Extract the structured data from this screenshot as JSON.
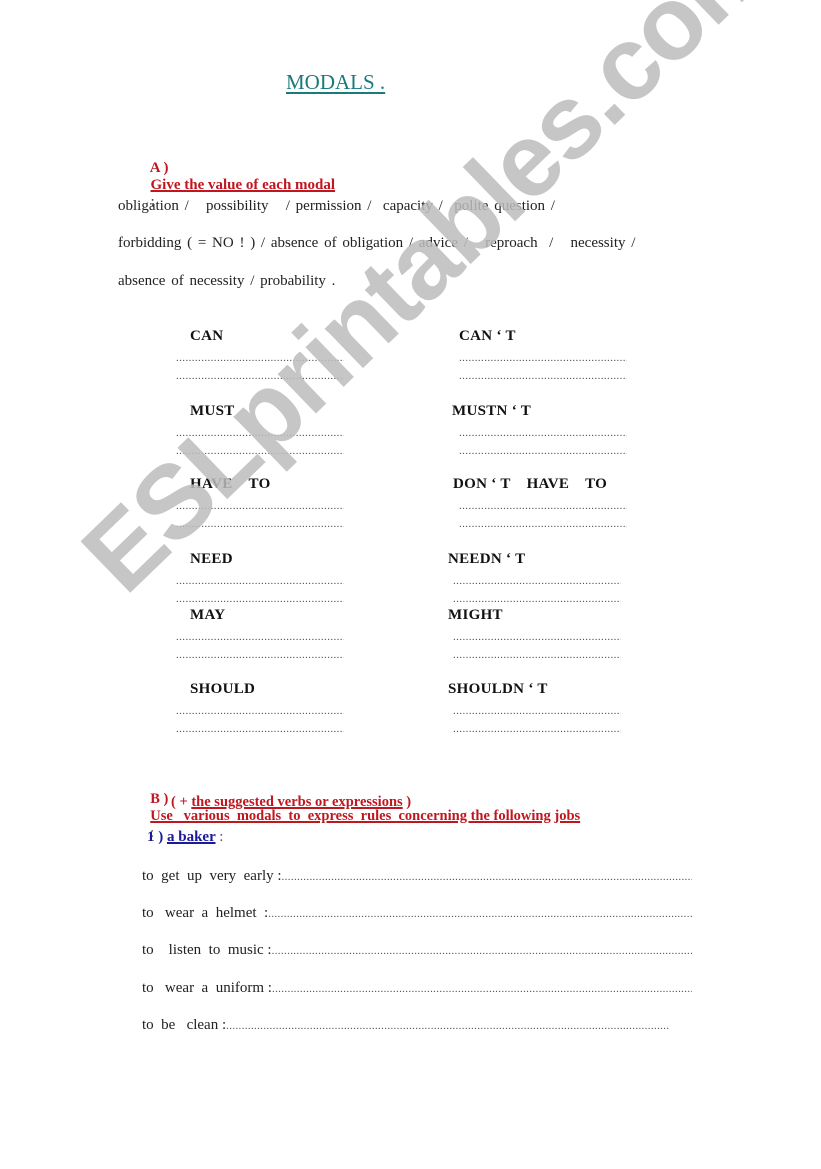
{
  "title": "MODALS .",
  "section_a": {
    "label": "A )",
    "instruction": "Give the value of each modal",
    "colon": ":",
    "value_lines": [
      "obligation /   possibility   / permission /  capacity /  polite question /",
      "forbidding ( = NO ! ) / absence of obligation / advice /   reproach  /   necessity /",
      "absence of necessity / probability ."
    ],
    "modals": [
      {
        "left": "CAN",
        "right": "CAN ‘ T"
      },
      {
        "left": "MUST",
        "right": "MUSTN ‘ T"
      },
      {
        "left": "HAVE    TO",
        "right": "DON ‘ T    HAVE    TO"
      },
      {
        "left": "NEED",
        "right": "NEEDN ‘ T"
      },
      {
        "left": "MAY",
        "right": "MIGHT"
      },
      {
        "left": "SHOULD",
        "right": "SHOULDN ‘ T"
      }
    ],
    "answer_line": "................................................................"
  },
  "section_b": {
    "label": "B )",
    "instruction": "Use   various  modals  to  express  rules  concerning the following jobs",
    "colon": ":",
    "sub_open": "( +",
    "sub_instruction": "the suggested verbs or expressions",
    "sub_close": ")",
    "job": {
      "number": "1 )",
      "name": "a baker",
      "colon": ":",
      "items": [
        "to  get  up  very  early :",
        "to   wear  a  helmet  :",
        "to    listen  to  music :",
        "to   wear  a  uniform :",
        "to  be   clean :"
      ],
      "fill_line": "..............................................................................................................................................."
    }
  },
  "watermark": "ESLprintables.com"
}
